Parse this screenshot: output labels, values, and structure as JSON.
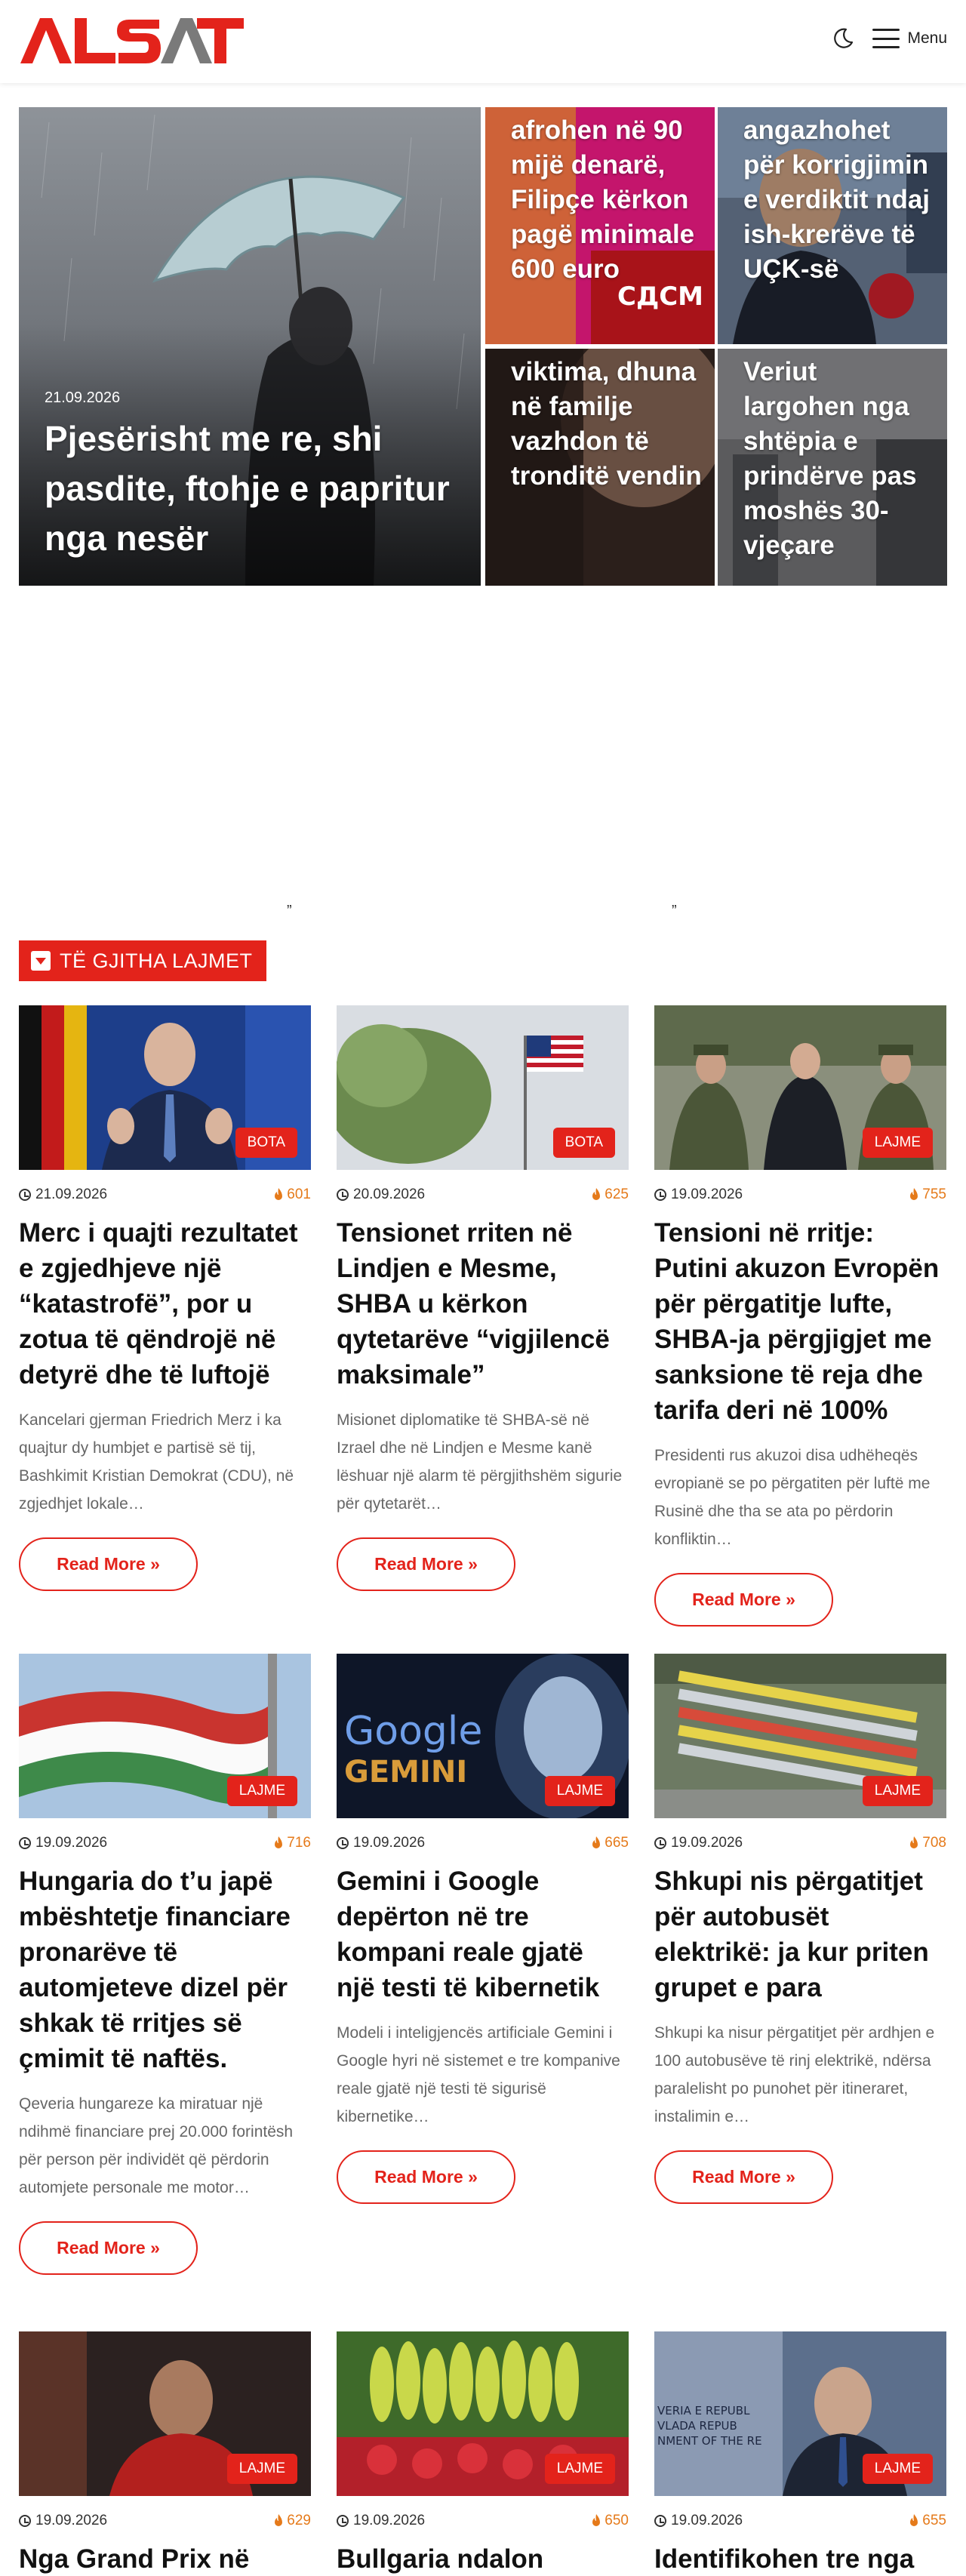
{
  "header": {
    "logo_text": "ALSAT",
    "menu_label": "Menu",
    "theme_toggle_icon": "moon-icon",
    "menu_icon": "hamburger-icon"
  },
  "hero": {
    "main": {
      "date": "21.09.2026",
      "title": "Pjesërisht me re, shi pasdite, ftohje e papritur nga nesër"
    },
    "tiles": [
      {
        "title": "afrohen në 90 mijë denarë, Filipçe kërkon pagë minimale 600 euro",
        "sign_text": "СДСМ"
      },
      {
        "title": "angazhohet për korrigjimin e verdiktit ndaj ish-krerëve të UÇK-së"
      },
      {
        "title": "viktima, dhuna në familje vazhdon të tronditë vendin"
      },
      {
        "title": "Veriut largohen nga shtëpia e prindërve pas moshës 30-vjeçare"
      }
    ]
  },
  "quote_marks": [
    "”",
    "”"
  ],
  "section": {
    "label": "TË GJITHA LAJMET",
    "icon": "chevron-down-box-icon"
  },
  "cards": [
    {
      "category": "BOTA",
      "date": "21.09.2026",
      "views": "601",
      "title": "Merc i quajti rezultatet e zgjedhjeve një “katastrofë”, por u zotua të qëndrojë në detyrë dhe të luftojë",
      "excerpt": "Kancelari gjerman Friedrich Merz i ka quajtur dy humbjet e partisë së tij, Bashkimit Kristian Demokrat (CDU), në zgjedhjet lokale…",
      "read_more": "Read More »"
    },
    {
      "category": "BOTA",
      "date": "20.09.2026",
      "views": "625",
      "title": "Tensionet rriten në Lindjen e Mesme, SHBA u kërkon qytetarëve “vigjilencë maksimale”",
      "excerpt": "Misionet diplomatike të SHBA-së në Izrael dhe në Lindjen e Mesme kanë lëshuar një alarm të përgjithshëm sigurie për qytetarët…",
      "read_more": "Read More »"
    },
    {
      "category": "LAJME",
      "date": "19.09.2026",
      "views": "755",
      "title": "Tensioni në rritje: Putini akuzon Evropën për përgatitje lufte, SHBA-ja përgjigjet me sanksione të reja dhe tarifa deri në 100%",
      "excerpt": "Presidenti rus akuzoi disa udhëheqës evropianë se po përgatiten për luftë me Rusinë dhe tha se ata po përdorin konfliktin…",
      "read_more": "Read More »"
    },
    {
      "category": "LAJME",
      "date": "19.09.2026",
      "views": "716",
      "title": "Hungaria do t’u japë mbështetje financiare pronarëve të automjeteve dizel për shkak të rritjes së çmimit të naftës.",
      "excerpt": "Qeveria hungareze ka miratuar një ndihmë financiare prej 20.000 forintësh për person për individët që përdorin automjete personale me motor…",
      "read_more": "Read More »"
    },
    {
      "category": "LAJME",
      "date": "19.09.2026",
      "views": "665",
      "title": "Gemini i Google depërton në tre kompani reale gjatë një testi të kibernetik",
      "excerpt": "Modeli i inteligjencës artificiale Gemini i Google hyri në sistemet e tre kompanive reale gjatë një testi të sigurisë kibernetike…",
      "read_more": "Read More »",
      "image_text": [
        "Google",
        "GEMINI"
      ]
    },
    {
      "category": "LAJME",
      "date": "19.09.2026",
      "views": "708",
      "title": "Shkupi nis përgatitjet për autobusët elektrikë: ja kur priten grupet e para",
      "excerpt": "Shkupi ka nisur përgatitjet për ardhjen e 100 autobusëve të rinj elektrikë, ndërsa paralelisht po punohet për itineraret, instalimin e…",
      "read_more": "Read More »"
    },
    {
      "category": "LAJME",
      "date": "19.09.2026",
      "views": "629",
      "title": "Nga Grand Prix në"
    },
    {
      "category": "LAJME",
      "date": "19.09.2026",
      "views": "650",
      "title": "Bullgaria ndalon"
    },
    {
      "category": "LAJME",
      "date": "19.09.2026",
      "views": "655",
      "title": "Identifikohen tre nga",
      "image_text": [
        "VERIA E REPUBL",
        "VLADA REPUB",
        "NMENT OF THE RE"
      ]
    }
  ],
  "colors": {
    "brand_red": "#e3231b",
    "views_orange": "#e57a1a",
    "excerpt_gray": "#666666"
  }
}
